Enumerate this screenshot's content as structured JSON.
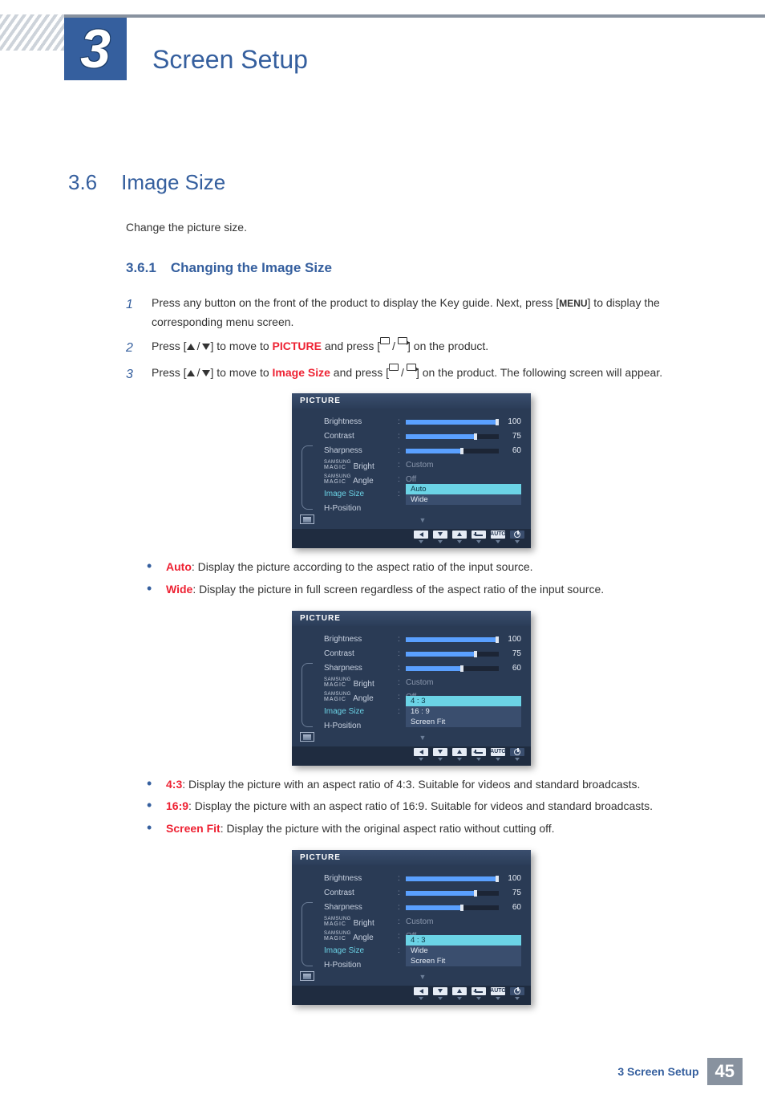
{
  "chapter": {
    "number": "3",
    "title": "Screen Setup"
  },
  "section": {
    "number": "3.6",
    "title": "Image Size",
    "lead": "Change the picture size."
  },
  "subsection": {
    "number": "3.6.1",
    "title": "Changing the Image Size"
  },
  "steps": {
    "s1": {
      "num": "1",
      "pre": "Press any button on the front of the product to display the Key guide. Next, press [",
      "menu": "MENU",
      "post": "] to display the corresponding menu screen."
    },
    "s2": {
      "num": "2",
      "pre": "Press [",
      "mid": "] to move to ",
      "kw": "PICTURE",
      "mid2": " and press [",
      "post": "] on the product."
    },
    "s3": {
      "num": "3",
      "pre": "Press [",
      "mid": "] to move to ",
      "kw": "Image Size",
      "mid2": " and press [",
      "post": "] on the product. The following screen will appear."
    }
  },
  "osd": {
    "title": "PICTURE",
    "rows": {
      "brightness": {
        "label": "Brightness",
        "value": "100",
        "fill": 100
      },
      "contrast": {
        "label": "Contrast",
        "value": "75",
        "fill": 75
      },
      "sharpness": {
        "label": "Sharpness",
        "value": "60",
        "fill": 60
      },
      "magicBright": {
        "label": "Bright",
        "text": "Custom"
      },
      "magicAngle": {
        "label": "Angle",
        "text": "Off"
      },
      "imageSize": {
        "label": "Image Size"
      },
      "hPosition": {
        "label": "H-Position"
      }
    },
    "foot_auto": "AUTO"
  },
  "osd1_options": {
    "a": "Auto",
    "b": "Wide"
  },
  "osd2_options": {
    "a": "4 : 3",
    "b": "16 : 9",
    "c": "Screen Fit"
  },
  "osd3_options": {
    "a": "4 : 3",
    "b": "Wide",
    "c": "Screen Fit"
  },
  "bulletsA": {
    "auto": {
      "kw": "Auto",
      "text": ": Display the picture according to the aspect ratio of the input source."
    },
    "wide": {
      "kw": "Wide",
      "text": ": Display the picture in full screen regardless of the aspect ratio of the input source."
    }
  },
  "bulletsB": {
    "r43": {
      "kw": "4:3",
      "text": ": Display the picture with an aspect ratio of 4:3. Suitable for videos and standard broadcasts."
    },
    "r169": {
      "kw": "16:9",
      "text": ": Display the picture with an aspect ratio of 16:9. Suitable for videos and standard broadcasts."
    },
    "fit": {
      "kw": "Screen Fit",
      "text": ": Display the picture with the original aspect ratio without cutting off."
    }
  },
  "magic": {
    "top": "SAMSUNG",
    "bot": "MAGIC"
  },
  "footer": {
    "label": "3 Screen Setup",
    "page": "45"
  }
}
